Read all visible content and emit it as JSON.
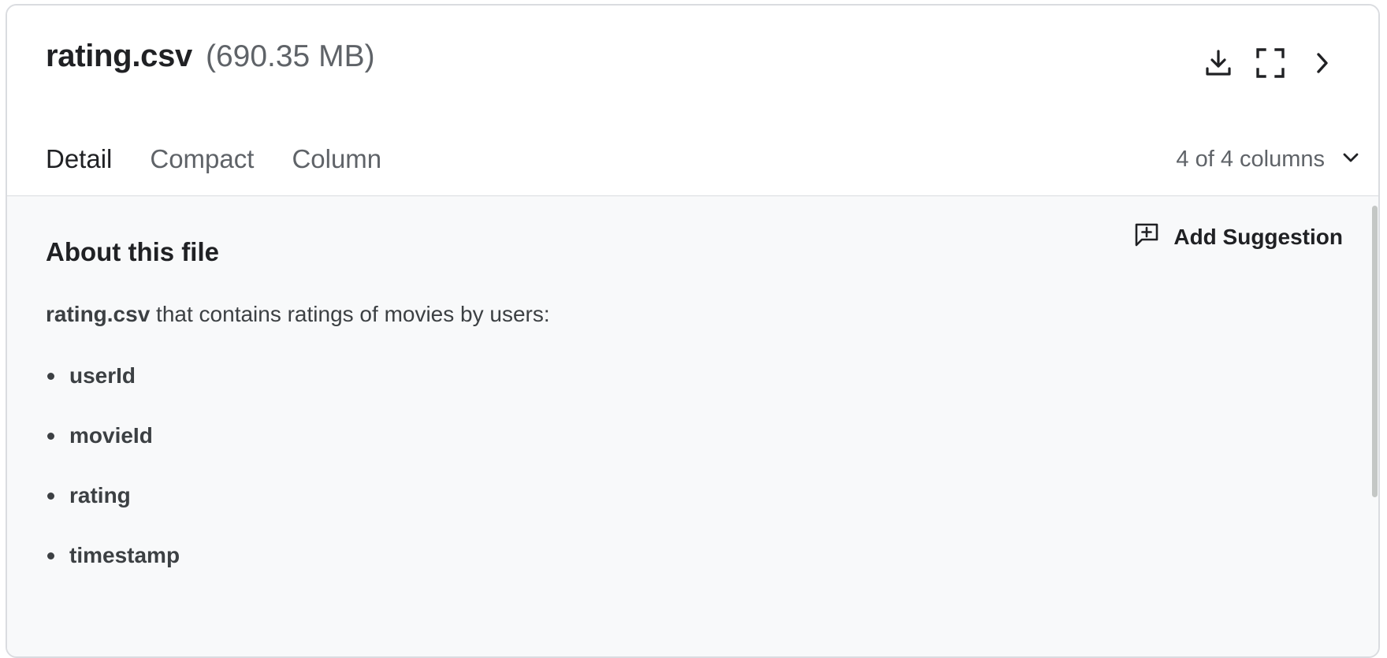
{
  "file": {
    "name": "rating.csv",
    "size": "(690.35 MB)"
  },
  "actions": {
    "download_icon": "download-icon",
    "fullscreen_icon": "fullscreen-icon",
    "expand_icon": "chevron-right-icon"
  },
  "tabs": [
    {
      "label": "Detail",
      "active": true
    },
    {
      "label": "Compact",
      "active": false
    },
    {
      "label": "Column",
      "active": false
    }
  ],
  "columns_selector": {
    "label": "4 of 4 columns",
    "icon": "chevron-down-icon"
  },
  "about": {
    "title": "About this file",
    "add_suggestion_label": "Add Suggestion",
    "add_suggestion_icon": "comment-plus-icon",
    "description_bold": "rating.csv",
    "description_rest": " that contains ratings of movies by users:",
    "columns": [
      "userId",
      "movieId",
      "rating",
      "timestamp"
    ]
  },
  "colors": {
    "text_primary": "#202124",
    "text_secondary": "#5f6368",
    "body_background": "#f8f9fa",
    "border": "#dadce0"
  }
}
